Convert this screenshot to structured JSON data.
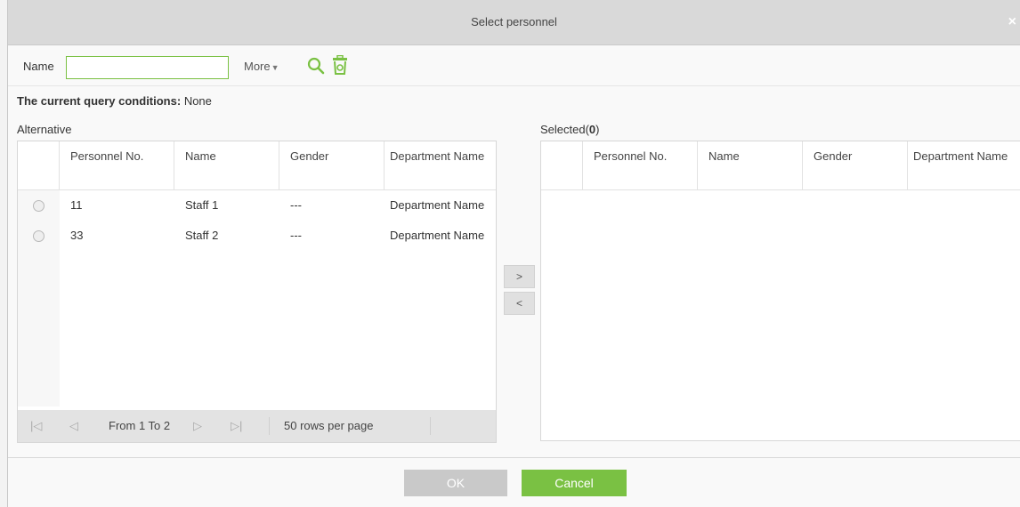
{
  "dialog": {
    "title": "Select personnel",
    "close_glyph": "×"
  },
  "search": {
    "name_label": "Name",
    "name_value": "",
    "more_label": "More",
    "query_label": "The current query conditions:",
    "query_value": "None"
  },
  "alternative": {
    "label": "Alternative",
    "columns": [
      "",
      "Personnel No.",
      "Name",
      "Gender",
      "Department Name"
    ],
    "rows": [
      {
        "no": "11",
        "name": "Staff 1",
        "gender": "---",
        "dept": "Department Name"
      },
      {
        "no": "33",
        "name": "Staff 2",
        "gender": "---",
        "dept": "Department Name"
      }
    ],
    "pager": {
      "range": "From 1 To 2",
      "rows_per_page": "50 rows per page"
    }
  },
  "selected": {
    "label_prefix": "Selected(",
    "count": "0",
    "label_suffix": ")",
    "columns": [
      "",
      "Personnel No.",
      "Name",
      "Gender",
      "Department Name"
    ]
  },
  "move": {
    "add": ">",
    "remove": "<"
  },
  "footer": {
    "ok_label": "OK",
    "cancel_label": "Cancel"
  },
  "colors": {
    "accent": "#7ac143",
    "titlebar": "#d9d9d9",
    "disabled": "#c9c9c9"
  }
}
